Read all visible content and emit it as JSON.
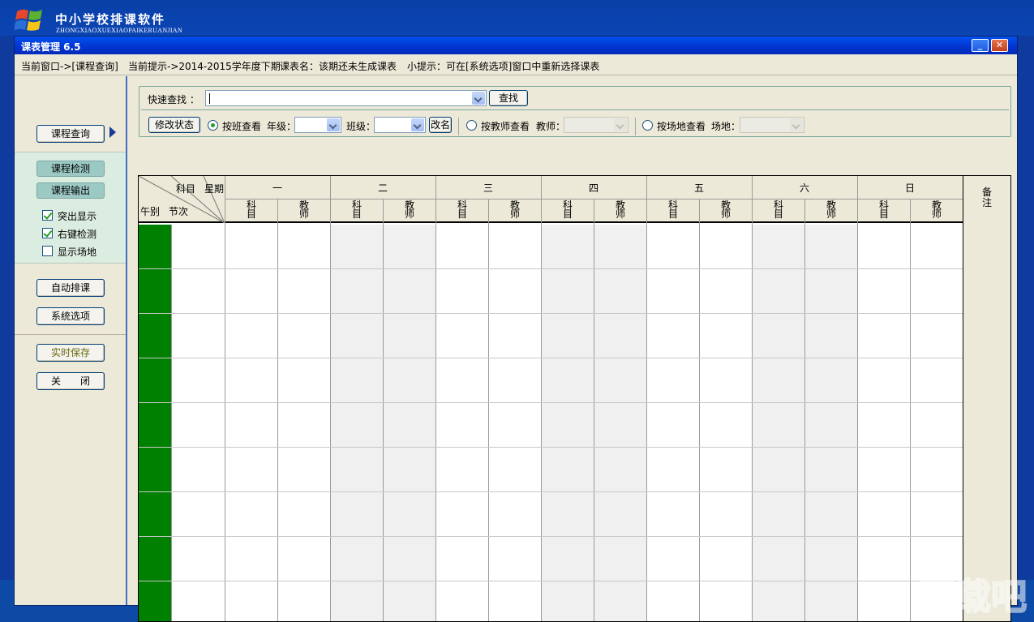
{
  "app": {
    "name": "中小学校排课软件",
    "pinyin": "ZHONGXIAOXUEXIAOPAIKERUANJIAN"
  },
  "window": {
    "title": "课表管理 6.5",
    "minimize_icon": "minimize-icon",
    "close_icon": "close-icon"
  },
  "status": {
    "current_window": "当前窗口->[课程查询]",
    "current_tip": "当前提示->2014-2015学年度下期",
    "schedule_name": "课表名：该期还未生成课表",
    "hint": "小提示：可在[系统选项]窗口中重新选择课表"
  },
  "left": {
    "query_button": "课程查询",
    "check_button": "课程检测",
    "output_button": "课程输出",
    "options": [
      {
        "label": "突出显示",
        "checked": true
      },
      {
        "label": "右键检测",
        "checked": true
      },
      {
        "label": "显示场地",
        "checked": false
      }
    ],
    "auto_schedule_button": "自动排课",
    "system_options_button": "系统选项",
    "save_button": "实时保存",
    "close_button": "关　　闭"
  },
  "search": {
    "quick_find_label": "快速查找 ：",
    "quick_find_value": "",
    "find_button": "查找",
    "modify_state_button": "修改状态",
    "by_class_label": "按班查看",
    "grade_label": "年级：",
    "class_label": "班级：",
    "rename_button": "改名",
    "by_teacher_label": "按教师查看",
    "teacher_label": "教师：",
    "by_venue_label": "按场地查看",
    "venue_label": "场地：",
    "selected_mode": "by_class"
  },
  "timetable": {
    "corner": {
      "subject": "科目",
      "weekday": "星期",
      "period_group": "午别",
      "period": "节次"
    },
    "days": [
      "一",
      "二",
      "三",
      "四",
      "五",
      "六",
      "日"
    ],
    "sub_subject": "科目",
    "sub_teacher": "教师",
    "remark": "备注",
    "row_count": 9,
    "colors": {
      "period_column": "#008000",
      "shaded_column": "#f0f0f0"
    }
  },
  "watermark": "下载吧"
}
